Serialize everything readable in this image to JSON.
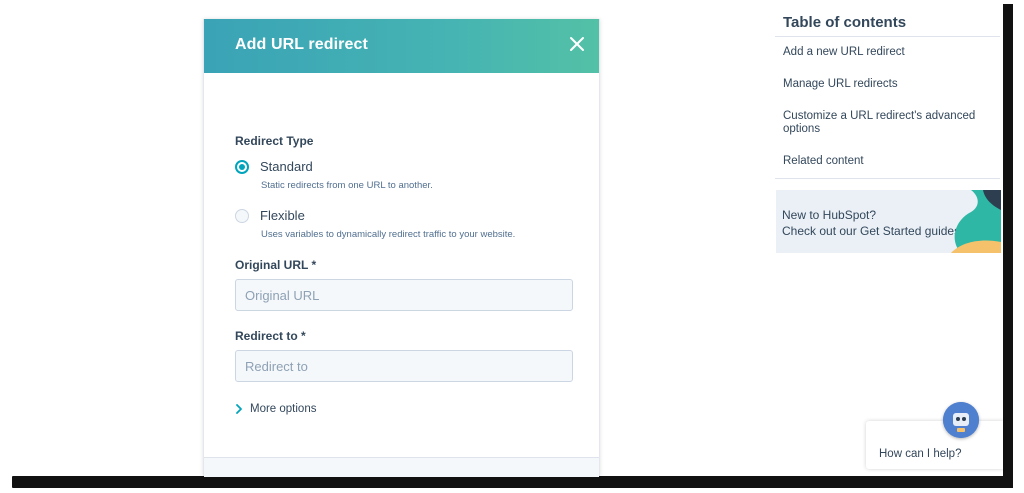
{
  "modal": {
    "title": "Add URL redirect",
    "redirect_type_label": "Redirect Type",
    "options": [
      {
        "label": "Standard",
        "description": "Static redirects from one URL to another.",
        "selected": true
      },
      {
        "label": "Flexible",
        "description": "Uses variables to dynamically redirect traffic to your website.",
        "selected": false
      }
    ],
    "original_url": {
      "label": "Original URL *",
      "placeholder": "Original URL",
      "value": ""
    },
    "redirect_to": {
      "label": "Redirect to *",
      "placeholder": "Redirect to",
      "value": ""
    },
    "more_options_label": "More options"
  },
  "toc": {
    "title": "Table of contents",
    "items": [
      {
        "label": "Add a new URL redirect"
      },
      {
        "label": "Manage URL redirects"
      },
      {
        "label": "Customize a URL redirect's advanced options"
      },
      {
        "label": "Related content"
      }
    ]
  },
  "promo": {
    "line1": "New to HubSpot?",
    "line2": "Check out our Get Started guides"
  },
  "chat": {
    "prompt": "How can I help?"
  },
  "colors": {
    "header_start": "#3aa3b6",
    "header_end": "#53c1a6",
    "accent": "#00a4bd",
    "text": "#33475b"
  },
  "icons": [
    "close-icon",
    "radio-checked",
    "radio-unchecked",
    "chevron-right-icon",
    "chat-avatar-icon"
  ]
}
